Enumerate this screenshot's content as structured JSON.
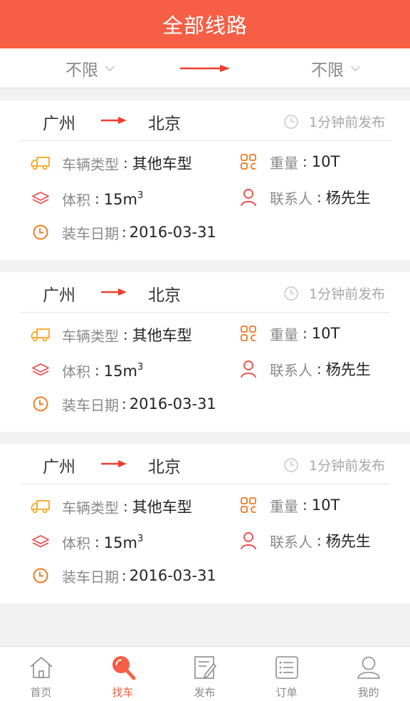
{
  "header": {
    "title": "全部线路"
  },
  "filters": {
    "from": "不限",
    "to": "不限"
  },
  "colors": {
    "accent": "#f65f45",
    "truck_icon": "#f5a623",
    "grid_icon": "#f0771f",
    "stack_icon": "#f04e4e",
    "person_icon": "#f04e4e",
    "clock_icon": "#f0771f"
  },
  "cards": [
    {
      "from": "广州",
      "to": "北京",
      "posted": "1分钟前发布",
      "type_label": "车辆类型",
      "type_value": "其他车型",
      "weight_label": "重量",
      "weight_value": "10T",
      "volume_label": "体积",
      "volume_value": "15m",
      "volume_unit_sup": "3",
      "contact_label": "联系人",
      "contact_value": "杨先生",
      "date_label": "装车日期",
      "date_value": "2016-03-31"
    },
    {
      "from": "广州",
      "to": "北京",
      "posted": "1分钟前发布",
      "type_label": "车辆类型",
      "type_value": "其他车型",
      "weight_label": "重量",
      "weight_value": "10T",
      "volume_label": "体积",
      "volume_value": "15m",
      "volume_unit_sup": "3",
      "contact_label": "联系人",
      "contact_value": "杨先生",
      "date_label": "装车日期",
      "date_value": "2016-03-31"
    },
    {
      "from": "广州",
      "to": "北京",
      "posted": "1分钟前发布",
      "type_label": "车辆类型",
      "type_value": "其他车型",
      "weight_label": "重量",
      "weight_value": "10T",
      "volume_label": "体积",
      "volume_value": "15m",
      "volume_unit_sup": "3",
      "contact_label": "联系人",
      "contact_value": "杨先生",
      "date_label": "装车日期",
      "date_value": "2016-03-31"
    }
  ],
  "tabbar": {
    "items": [
      {
        "label": "首页",
        "icon": "home-icon",
        "active": false
      },
      {
        "label": "找车",
        "icon": "search-icon",
        "active": true
      },
      {
        "label": "发布",
        "icon": "publish-icon",
        "active": false
      },
      {
        "label": "订单",
        "icon": "order-icon",
        "active": false
      },
      {
        "label": "我的",
        "icon": "profile-icon",
        "active": false
      }
    ]
  }
}
